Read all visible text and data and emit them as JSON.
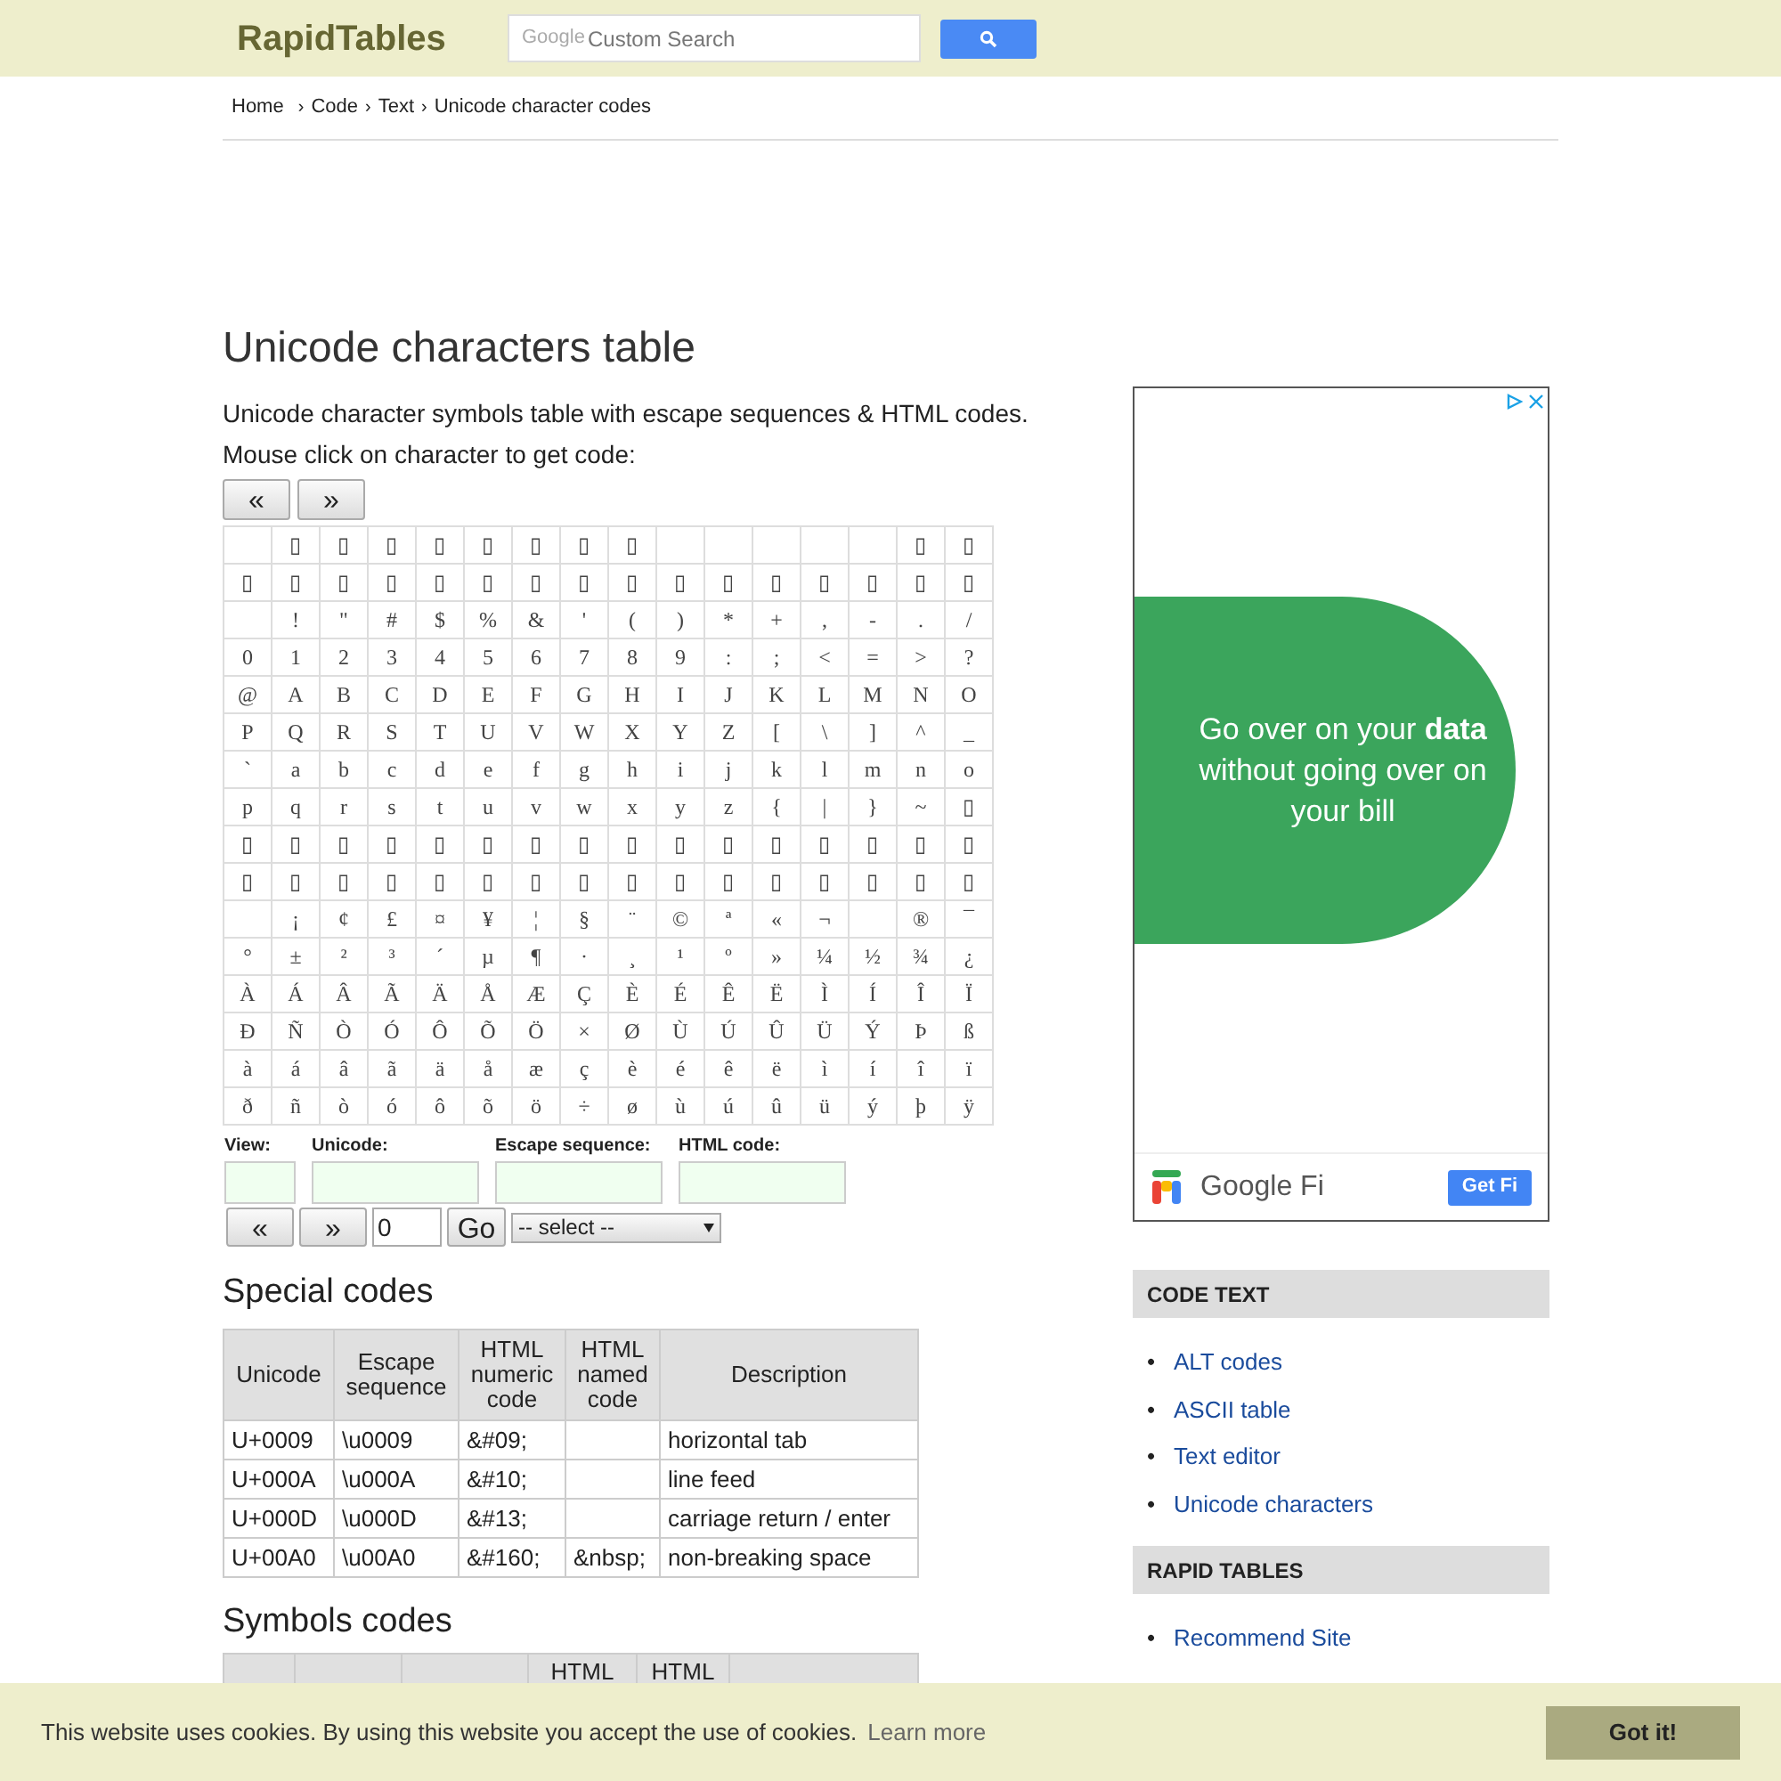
{
  "header": {
    "logo": "RapidTables",
    "search": {
      "brand": "Google",
      "placeholder": "Custom Search"
    }
  },
  "breadcrumb": {
    "items": [
      "Home",
      "Code",
      "Text",
      "Unicode character codes"
    ],
    "separator": "›"
  },
  "title": "Unicode characters table",
  "intro": [
    "Unicode character symbols table with escape sequences & HTML codes.",
    "Mouse click on character to get code:"
  ],
  "page_buttons": [
    "«",
    "»"
  ],
  "char_grid": {
    "rows": [
      [
        {},
        {
          "char": "▯"
        },
        {
          "char": "▯"
        },
        {
          "char": "▯"
        },
        {
          "char": "▯"
        },
        {
          "char": "▯"
        },
        {
          "char": "▯"
        },
        {
          "char": "▯"
        },
        {
          "char": "▯"
        },
        {},
        {},
        {},
        {},
        {},
        {
          "char": "▯"
        },
        {
          "char": "▯"
        }
      ],
      [
        {
          "char": "▯"
        },
        {
          "char": "▯"
        },
        {
          "char": "▯"
        },
        {
          "char": "▯"
        },
        {
          "char": "▯"
        },
        {
          "char": "▯"
        },
        {
          "char": "▯"
        },
        {
          "char": "▯"
        },
        {
          "char": "▯"
        },
        {
          "char": "▯"
        },
        {
          "char": "▯"
        },
        {
          "char": "▯"
        },
        {
          "char": "▯"
        },
        {
          "char": "▯"
        },
        {
          "char": "▯"
        },
        {
          "char": "▯"
        }
      ],
      [
        {},
        {
          "char": "!"
        },
        {
          "char": "\""
        },
        {
          "char": "#"
        },
        {
          "char": "$"
        },
        {
          "char": "%"
        },
        {
          "char": "&"
        },
        {
          "char": "'"
        },
        {
          "char": "("
        },
        {
          "char": ")"
        },
        {
          "char": "*"
        },
        {
          "char": "+"
        },
        {
          "char": ","
        },
        {
          "char": "-"
        },
        {
          "char": "."
        },
        {
          "char": "/"
        }
      ],
      [
        {
          "char": "0"
        },
        {
          "char": "1"
        },
        {
          "char": "2"
        },
        {
          "char": "3"
        },
        {
          "char": "4"
        },
        {
          "char": "5"
        },
        {
          "char": "6"
        },
        {
          "char": "7"
        },
        {
          "char": "8"
        },
        {
          "char": "9"
        },
        {
          "char": ":"
        },
        {
          "char": ";"
        },
        {
          "char": "<"
        },
        {
          "char": "="
        },
        {
          "char": ">"
        },
        {
          "char": "?"
        }
      ],
      [
        {
          "char": "@"
        },
        {
          "char": "A"
        },
        {
          "char": "B"
        },
        {
          "char": "C"
        },
        {
          "char": "D"
        },
        {
          "char": "E"
        },
        {
          "char": "F"
        },
        {
          "char": "G"
        },
        {
          "char": "H"
        },
        {
          "char": "I"
        },
        {
          "char": "J"
        },
        {
          "char": "K"
        },
        {
          "char": "L"
        },
        {
          "char": "M"
        },
        {
          "char": "N"
        },
        {
          "char": "O"
        }
      ],
      [
        {
          "char": "P"
        },
        {
          "char": "Q"
        },
        {
          "char": "R"
        },
        {
          "char": "S"
        },
        {
          "char": "T"
        },
        {
          "char": "U"
        },
        {
          "char": "V"
        },
        {
          "char": "W"
        },
        {
          "char": "X"
        },
        {
          "char": "Y"
        },
        {
          "char": "Z"
        },
        {
          "char": "["
        },
        {
          "char": "\\"
        },
        {
          "char": "]"
        },
        {
          "char": "^"
        },
        {
          "char": "_"
        }
      ],
      [
        {
          "char": "`"
        },
        {
          "char": "a"
        },
        {
          "char": "b"
        },
        {
          "char": "c"
        },
        {
          "char": "d"
        },
        {
          "char": "e"
        },
        {
          "char": "f"
        },
        {
          "char": "g"
        },
        {
          "char": "h"
        },
        {
          "char": "i"
        },
        {
          "char": "j"
        },
        {
          "char": "k"
        },
        {
          "char": "l"
        },
        {
          "char": "m"
        },
        {
          "char": "n"
        },
        {
          "char": "o"
        }
      ],
      [
        {
          "char": "p"
        },
        {
          "char": "q"
        },
        {
          "char": "r"
        },
        {
          "char": "s"
        },
        {
          "char": "t"
        },
        {
          "char": "u"
        },
        {
          "char": "v"
        },
        {
          "char": "w"
        },
        {
          "char": "x"
        },
        {
          "char": "y"
        },
        {
          "char": "z"
        },
        {
          "char": "{"
        },
        {
          "char": "|"
        },
        {
          "char": "}"
        },
        {
          "char": "~"
        },
        {
          "char": "▯"
        }
      ],
      [
        {
          "char": "▯"
        },
        {
          "char": "▯"
        },
        {
          "char": "▯"
        },
        {
          "char": "▯"
        },
        {
          "char": "▯"
        },
        {
          "char": "▯"
        },
        {
          "char": "▯"
        },
        {
          "char": "▯"
        },
        {
          "char": "▯"
        },
        {
          "char": "▯"
        },
        {
          "char": "▯"
        },
        {
          "char": "▯"
        },
        {
          "char": "▯"
        },
        {
          "char": "▯"
        },
        {
          "char": "▯"
        },
        {
          "char": "▯"
        }
      ],
      [
        {
          "char": "▯"
        },
        {
          "char": "▯"
        },
        {
          "char": "▯"
        },
        {
          "char": "▯"
        },
        {
          "char": "▯"
        },
        {
          "char": "▯"
        },
        {
          "char": "▯"
        },
        {
          "char": "▯"
        },
        {
          "char": "▯"
        },
        {
          "char": "▯"
        },
        {
          "char": "▯"
        },
        {
          "char": "▯"
        },
        {
          "char": "▯"
        },
        {
          "char": "▯"
        },
        {
          "char": "▯"
        },
        {
          "char": "▯"
        }
      ],
      [
        {},
        {
          "char": "¡"
        },
        {
          "char": "¢"
        },
        {
          "char": "£"
        },
        {
          "char": "¤"
        },
        {
          "char": "¥"
        },
        {
          "char": "¦"
        },
        {
          "char": "§"
        },
        {
          "char": "¨"
        },
        {
          "char": "©"
        },
        {
          "char": "ª"
        },
        {
          "char": "«"
        },
        {
          "char": "¬"
        },
        {},
        {
          "char": "®"
        },
        {
          "char": "¯"
        }
      ],
      [
        {
          "char": "°"
        },
        {
          "char": "±"
        },
        {
          "char": "²"
        },
        {
          "char": "³"
        },
        {
          "char": "´"
        },
        {
          "char": "µ"
        },
        {
          "char": "¶"
        },
        {
          "char": "·"
        },
        {
          "char": "¸"
        },
        {
          "char": "¹"
        },
        {
          "char": "º"
        },
        {
          "char": "»"
        },
        {
          "char": "¼"
        },
        {
          "char": "½"
        },
        {
          "char": "¾"
        },
        {
          "char": "¿"
        }
      ],
      [
        {
          "char": "À"
        },
        {
          "char": "Á"
        },
        {
          "char": "Â"
        },
        {
          "char": "Ã"
        },
        {
          "char": "Ä"
        },
        {
          "char": "Å"
        },
        {
          "char": "Æ"
        },
        {
          "char": "Ç"
        },
        {
          "char": "È"
        },
        {
          "char": "É"
        },
        {
          "char": "Ê"
        },
        {
          "char": "Ë"
        },
        {
          "char": "Ì"
        },
        {
          "char": "Í"
        },
        {
          "char": "Î"
        },
        {
          "char": "Ï"
        }
      ],
      [
        {
          "char": "Ð"
        },
        {
          "char": "Ñ"
        },
        {
          "char": "Ò"
        },
        {
          "char": "Ó"
        },
        {
          "char": "Ô"
        },
        {
          "char": "Õ"
        },
        {
          "char": "Ö"
        },
        {
          "char": "×"
        },
        {
          "char": "Ø"
        },
        {
          "char": "Ù"
        },
        {
          "char": "Ú"
        },
        {
          "char": "Û"
        },
        {
          "char": "Ü"
        },
        {
          "char": "Ý"
        },
        {
          "char": "Þ"
        },
        {
          "char": "ß"
        }
      ],
      [
        {
          "char": "à"
        },
        {
          "char": "á"
        },
        {
          "char": "â"
        },
        {
          "char": "ã"
        },
        {
          "char": "ä"
        },
        {
          "char": "å"
        },
        {
          "char": "æ"
        },
        {
          "char": "ç"
        },
        {
          "char": "è"
        },
        {
          "char": "é"
        },
        {
          "char": "ê"
        },
        {
          "char": "ë"
        },
        {
          "char": "ì"
        },
        {
          "char": "í"
        },
        {
          "char": "î"
        },
        {
          "char": "ï"
        }
      ],
      [
        {
          "char": "ð"
        },
        {
          "char": "ñ"
        },
        {
          "char": "ò"
        },
        {
          "char": "ó"
        },
        {
          "char": "ô"
        },
        {
          "char": "õ"
        },
        {
          "char": "ö"
        },
        {
          "char": "÷"
        },
        {
          "char": "ø"
        },
        {
          "char": "ù"
        },
        {
          "char": "ú"
        },
        {
          "char": "û"
        },
        {
          "char": "ü"
        },
        {
          "char": "ý"
        },
        {
          "char": "þ"
        },
        {
          "char": "ÿ"
        }
      ]
    ]
  },
  "fields": [
    {
      "label": "View:"
    },
    {
      "label": "Unicode:"
    },
    {
      "label": "Escape sequence:"
    },
    {
      "label": "HTML code:"
    }
  ],
  "nav": {
    "prev": "«",
    "next": "»",
    "page_value": "0",
    "go": "Go",
    "select": "-- select --"
  },
  "special_codes": {
    "heading": "Special codes",
    "columns": [
      "Unicode",
      "Escape sequence",
      "HTML numeric code",
      "HTML named code",
      "Description"
    ],
    "rows": [
      [
        "U+0009",
        "\\u0009",
        "&#09;",
        "",
        "horizontal tab"
      ],
      [
        "U+000A",
        "\\u000A",
        "&#10;",
        "",
        "line feed"
      ],
      [
        "U+000D",
        "\\u000D",
        "&#13;",
        "",
        "carriage return / enter"
      ],
      [
        "U+00A0",
        "\\u00A0",
        "&#160;",
        "&nbsp;",
        "non-breaking space"
      ]
    ]
  },
  "symbols_codes": {
    "heading": "Symbols codes",
    "columns": [
      {},
      {},
      {},
      {
        "label": "HTML"
      },
      {
        "label": "HTML"
      },
      {}
    ]
  },
  "ad": {
    "headline": "Go over on your **data** without going over on your bill",
    "brand": "Google Fi",
    "cta": "Get Fi"
  },
  "sidebar": [
    {
      "title": "CODE TEXT",
      "bullet": "•",
      "links": [
        "ALT codes",
        "ASCII table",
        "Text editor",
        "Unicode characters"
      ]
    },
    {
      "title": "RAPID TABLES",
      "bullet": "•",
      "links": [
        "Recommend Site"
      ]
    }
  ],
  "cookie_bar": {
    "text": "This website uses cookies. By using this website you accept the use of cookies.",
    "link": "Learn more",
    "button": "Got it!"
  }
}
